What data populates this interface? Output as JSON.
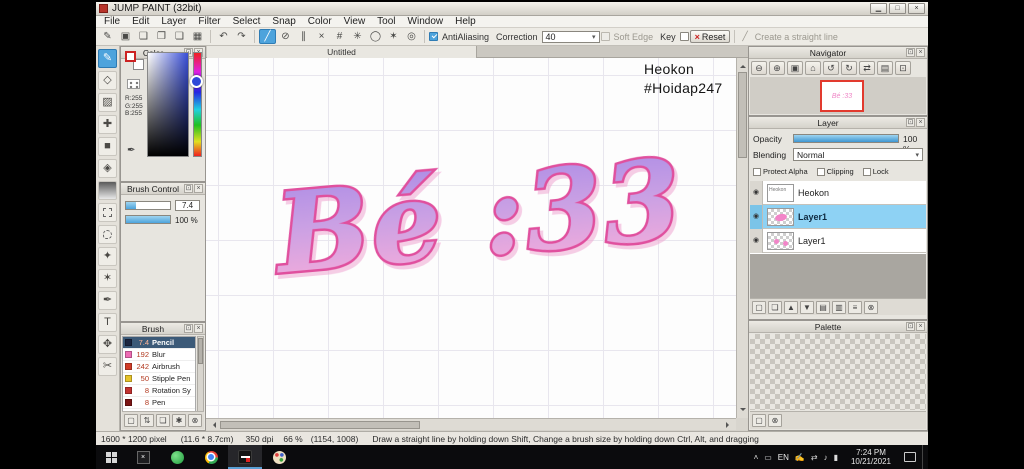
{
  "window": {
    "title": "JUMP PAINT (32bit)"
  },
  "menu": {
    "items": [
      "File",
      "Edit",
      "Layer",
      "Filter",
      "Select",
      "Snap",
      "Color",
      "View",
      "Tool",
      "Window",
      "Help"
    ]
  },
  "toolbar": {
    "antialiasing_label": "AntiAliasing",
    "correction_label": "Correction",
    "correction_value": "40",
    "soft_edge_label": "Soft Edge",
    "key_label": "Key",
    "reset_label": "Reset",
    "create_line_label": "Create a straight line"
  },
  "icons": {
    "minimize": "▁",
    "maximize": "□",
    "close": "×",
    "popout": "⊡",
    "undo": "↶",
    "redo": "↷",
    "straight_line": "╱",
    "dropdown": "▾",
    "reset_x": "×",
    "eye": "◉",
    "eyedropper": "✒",
    "toolbar_left": [
      "✎",
      "▣",
      "❑",
      "❐",
      "❏",
      "▦"
    ],
    "snaps": [
      "⊘",
      "∥",
      "×",
      "#",
      "✳",
      "◯",
      "✶",
      "◎"
    ],
    "tools": [
      "✎",
      "◇",
      "▨",
      "✚",
      "■",
      "◈",
      "",
      "",
      "",
      "✦",
      "✶",
      "✒",
      "T",
      "✥",
      "✂"
    ],
    "navigator": [
      "⊖",
      "⊕",
      "▣",
      "⌂",
      "↺",
      "↻",
      "⇄",
      "▤",
      "⊡"
    ],
    "layer_buttons": [
      "▢",
      "❏",
      "▲",
      "▼",
      "▤",
      "▥",
      "≡",
      "⊗"
    ],
    "brush_buttons": [
      "▢",
      "⇅",
      "❏",
      "✱",
      "⊗"
    ],
    "palette_buttons": [
      "▢",
      "⊗"
    ],
    "tray": [
      "˄",
      "▭",
      "✍",
      "⇄",
      "♪",
      "▮"
    ]
  },
  "color_panel": {
    "title": "Color",
    "r": "R:255",
    "g": "G:255",
    "b": "B:255"
  },
  "brush_control": {
    "title": "Brush Control",
    "size": "7.4",
    "opacity": "100 %"
  },
  "brush_panel": {
    "title": "Brush",
    "items": [
      {
        "size": "7.4",
        "name": "Pencil",
        "chip": "#1b2640"
      },
      {
        "size": "192",
        "name": "Blur",
        "chip": "#ee6cb4"
      },
      {
        "size": "242",
        "name": "Airbrush",
        "chip": "#d23c28"
      },
      {
        "size": "50",
        "name": "Stipple Pen",
        "chip": "#e6c32a"
      },
      {
        "size": "8",
        "name": "Rotation Sy",
        "chip": "#c23230"
      },
      {
        "size": "8",
        "name": "Pen",
        "chip": "#7c1616"
      }
    ]
  },
  "canvas": {
    "tab": "Untitled",
    "signature_line1": "Heokon",
    "signature_line2": "#Hoidap247",
    "lettering": "Bé :33"
  },
  "navigator": {
    "title": "Navigator"
  },
  "layer_panel": {
    "title": "Layer",
    "opacity_label": "Opacity",
    "opacity_value": "100 %",
    "blending_label": "Blending",
    "blending_value": "Normal",
    "protect_alpha_label": "Protect Alpha",
    "clipping_label": "Clipping",
    "lock_label": "Lock",
    "layers": [
      {
        "name": "Heokon"
      },
      {
        "name": "Layer1"
      },
      {
        "name": "Layer1"
      }
    ]
  },
  "palette_panel": {
    "title": "Palette"
  },
  "status": {
    "size": "1600 * 1200 pixel",
    "dimensions": "(11.6 * 8.7cm)",
    "dpi": "350 dpi",
    "zoom": "66 %",
    "coords": "(1154, 1008)",
    "hint": "Draw a straight line by holding down Shift, Change a brush size by holding down Ctrl, Alt, and dragging"
  },
  "taskbar": {
    "language": "EN",
    "time": "7:24 PM",
    "date": "10/21/2021"
  },
  "colors": {
    "accent_blue": "#4da3dc",
    "layer_selected": "#8ed2f4",
    "brush_selected_row": "#3c5a78",
    "lettering_purple": "#a98ae6",
    "lettering_pink": "#fbaed9",
    "lettering_outline": "#e0509e",
    "navigator_frame_red": "#e23a2e"
  }
}
